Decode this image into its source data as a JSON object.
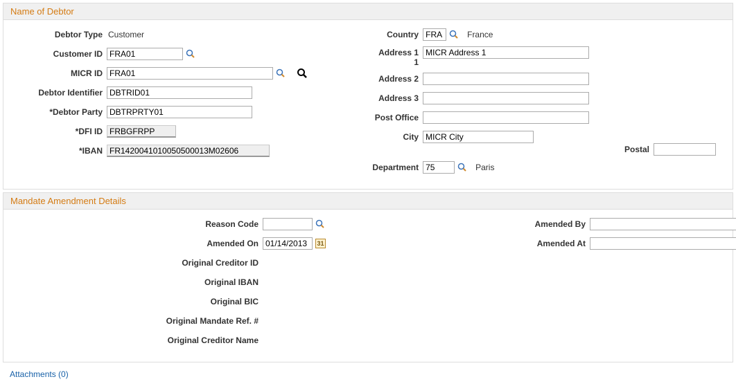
{
  "debtor": {
    "section_title": "Name of Debtor",
    "type_label": "Debtor Type",
    "type_value": "Customer",
    "customer_id_label": "Customer ID",
    "customer_id_value": "FRA01",
    "micr_id_label": "MICR ID",
    "micr_id_value": "FRA01",
    "identifier_label": "Debtor Identifier",
    "identifier_value": "DBTRID01",
    "party_label": "*Debtor Party",
    "party_value": "DBTRPRTY01",
    "dfi_label": "*DFI ID",
    "dfi_value": "FRBGFRPP",
    "iban_label": "*IBAN",
    "iban_value": "FR1420041010050500013M02606",
    "country_label": "Country",
    "country_value": "FRA",
    "country_text": "France",
    "address1_label": "Address 1",
    "address1_value": "MICR Address 1",
    "address2_label": "Address 2",
    "address2_value": "",
    "address3_label": "Address 3",
    "address3_value": "",
    "postoffice_label": "Post Office",
    "postoffice_value": "",
    "city_label": "City",
    "city_value": "MICR City",
    "postal_label": "Postal",
    "postal_value": "",
    "department_label": "Department",
    "department_value": "75",
    "department_text": "Paris"
  },
  "mandate": {
    "section_title": "Mandate Amendment Details",
    "reason_label": "Reason Code",
    "reason_value": "",
    "amended_on_label": "Amended On",
    "amended_on_value": "01/14/2013",
    "amended_by_label": "Amended By",
    "amended_by_value": "",
    "amended_at_label": "Amended At",
    "amended_at_value": "",
    "orig_creditor_id": "Original Creditor ID",
    "orig_iban": "Original IBAN",
    "orig_bic": "Original BIC",
    "orig_mandate_ref": "Original Mandate Ref. #",
    "orig_creditor_name": "Original Creditor Name"
  },
  "attachments_label": "Attachments (0)",
  "cal_day": "31"
}
